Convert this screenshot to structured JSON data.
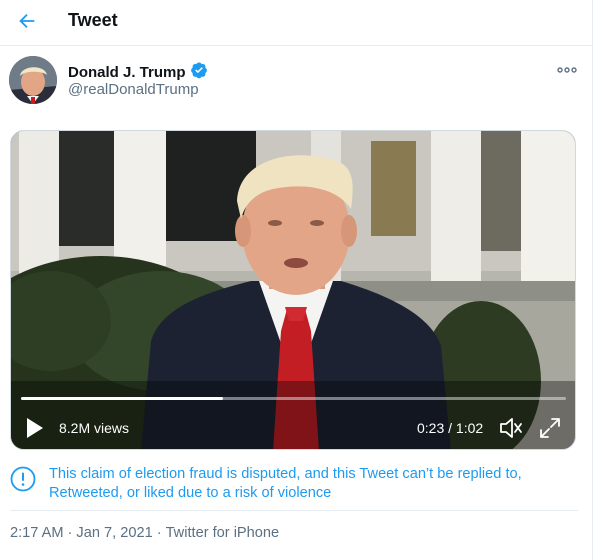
{
  "header": {
    "title": "Tweet"
  },
  "author": {
    "display_name": "Donald J. Trump",
    "handle": "@realDonaldTrump",
    "verified": true
  },
  "video": {
    "views": "8.2M views",
    "time": "0:23 / 1:02",
    "progress": 0.37
  },
  "notice": {
    "text": "This claim of election fraud is disputed, and this Tweet can’t be replied to, Retweeted, or liked due to a risk of violence"
  },
  "meta": {
    "time": "2:17 AM",
    "date": "Jan 7, 2021",
    "separator": "·",
    "source": "Twitter for iPhone"
  },
  "colors": {
    "accent": "#1d9bf0",
    "verified": "#1d9bf0",
    "secondary_text": "#5b7083"
  },
  "icons": {
    "back": "arrow-left-icon",
    "verified": "verified-badge-icon",
    "more": "more-horizontal-icon",
    "play": "play-icon",
    "volume": "volume-icon",
    "fullscreen": "fullscreen-icon",
    "warning": "info-circle-icon"
  }
}
